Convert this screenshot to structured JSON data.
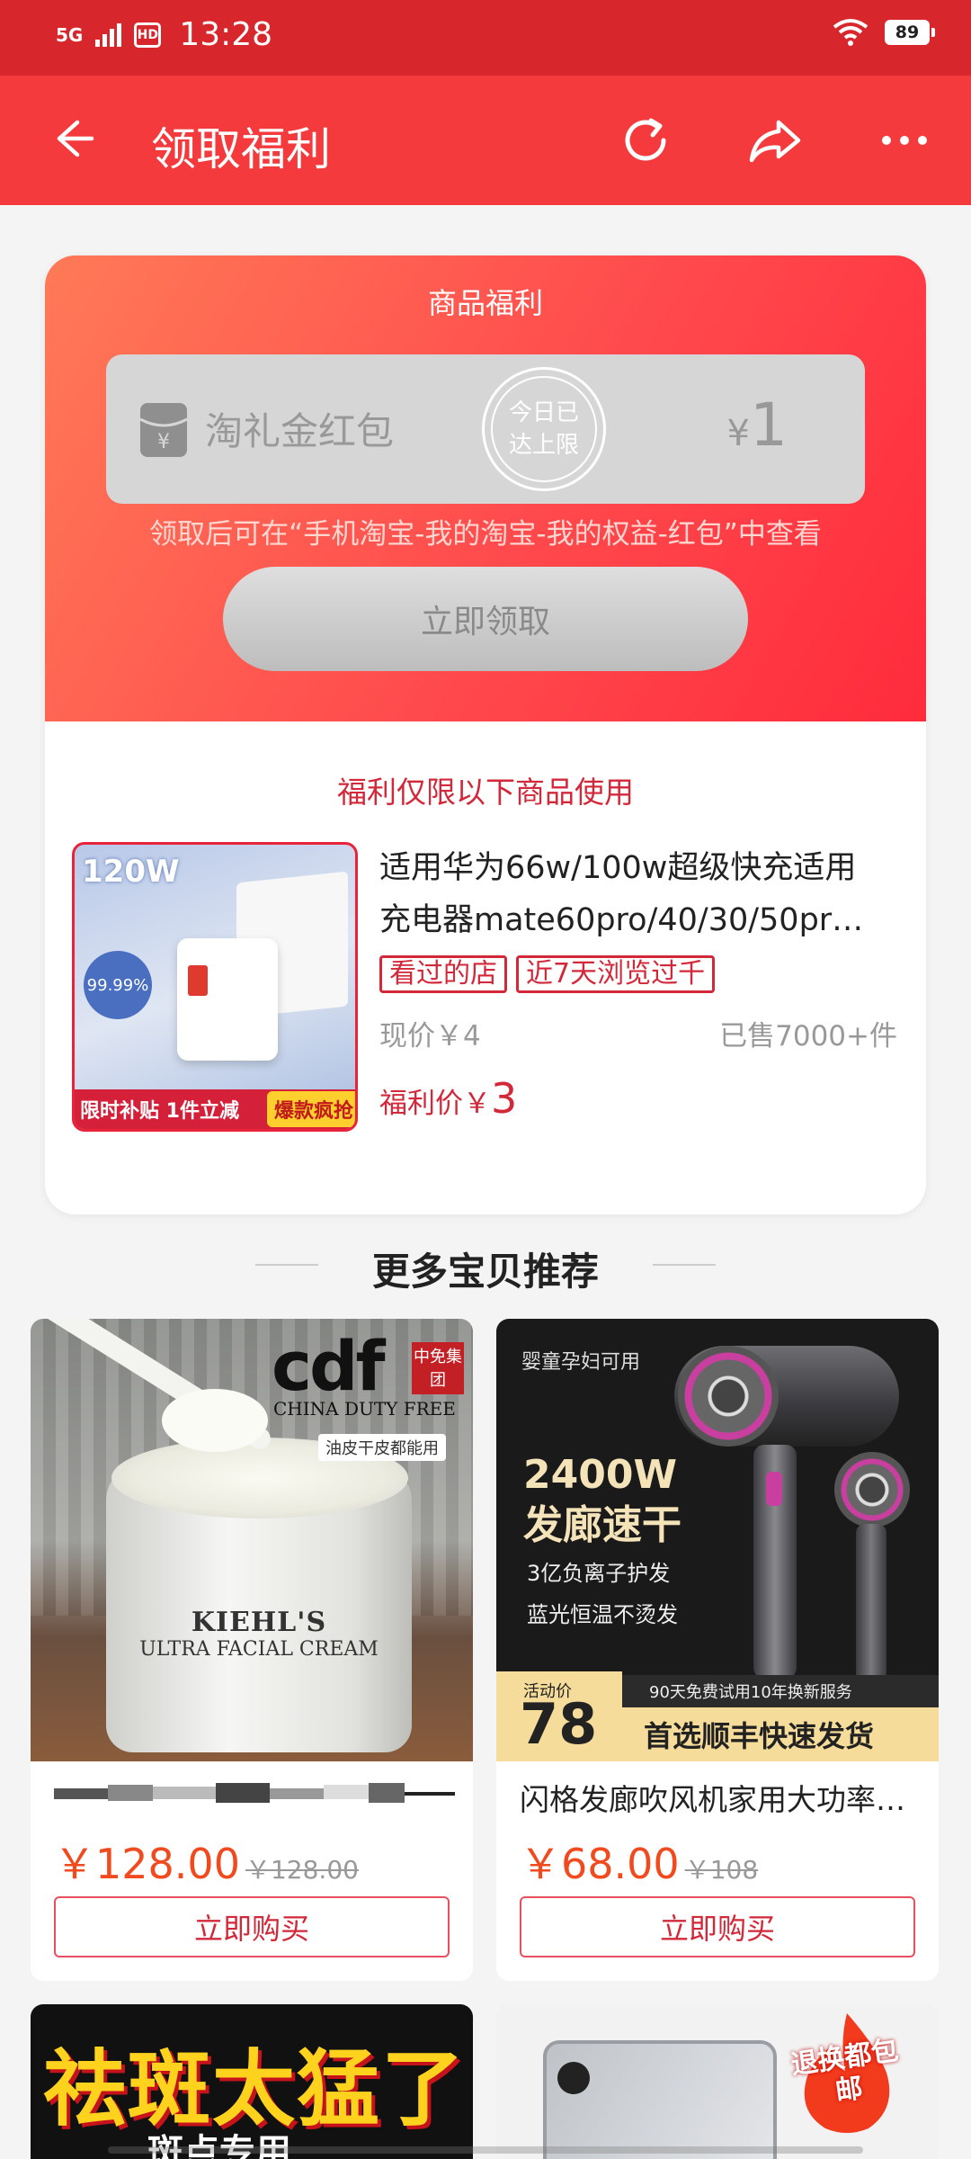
{
  "status_bar": {
    "network": "5G",
    "hd": "HD",
    "time": "13:28",
    "battery": "89"
  },
  "nav": {
    "title": "领取福利",
    "back_icon": "back-arrow-icon",
    "refresh_icon": "refresh-icon",
    "share_icon": "share-icon",
    "more_icon": "more-icon"
  },
  "welfare": {
    "heading": "商品福利",
    "coupon_name": "淘礼金红包",
    "stamp_text": "今日已达上限",
    "currency": "¥",
    "amount": "1",
    "note": "领取后可在“手机淘宝-我的淘宝-我的权益-红包”中查看",
    "claim_label": "立即领取",
    "limit_text": "福利仅限以下商品使用"
  },
  "product": {
    "image_tag": "120W",
    "image_badge": "99.99%",
    "image_footer": "限时补贴 1件立减",
    "image_footer_hot": "爆款疯抢",
    "title_line1": "适用华为66w/100w超级快充适用",
    "title_line2": "充电器mate60pro/40/30/50pr…",
    "tags": [
      "看过的店",
      "近7天浏览过千"
    ],
    "now_price": "现价￥4",
    "sold": "已售7000+件",
    "welfare_label": "福利价￥",
    "welfare_price": "3"
  },
  "recommend": {
    "title": "更多宝贝推荐",
    "items": [
      {
        "title": "",
        "price": "￥128.00",
        "orig_price": "￥128.00",
        "buy_label": "立即购买",
        "img": {
          "brand": "cdf",
          "brand_tag": "中免集团",
          "brand_sub": "CHINA DUTY FREE",
          "chip": "油皮干皮都能用",
          "label_brand": "KIEHL'S",
          "label_name": "ULTRA FACIAL CREAM"
        }
      },
      {
        "title": "闪格发廊吹风机家用大功率…",
        "price": "￥68.00",
        "orig_price": "￥108",
        "buy_label": "立即购买",
        "img": {
          "small": "婴童孕妇可用",
          "big1": "2400W",
          "big2": "发廊速干",
          "sub1": "3亿负离子护发",
          "sub2": "蓝光恒温不烫发",
          "promo_label": "活动价",
          "promo_price": "78",
          "promo_strip": "90天免费试用10年换新服务",
          "promo_right": "首选顺丰快速发货"
        }
      }
    ],
    "partial": [
      {
        "big": "祛斑太猛了",
        "small": "斑点专用"
      },
      {
        "badge": "退换都包邮"
      }
    ]
  },
  "colors": {
    "status_bar": "#d7262c",
    "nav_bar": "#f43a3d",
    "accent_red": "#d2283a",
    "price_orange": "#f04a1e"
  }
}
